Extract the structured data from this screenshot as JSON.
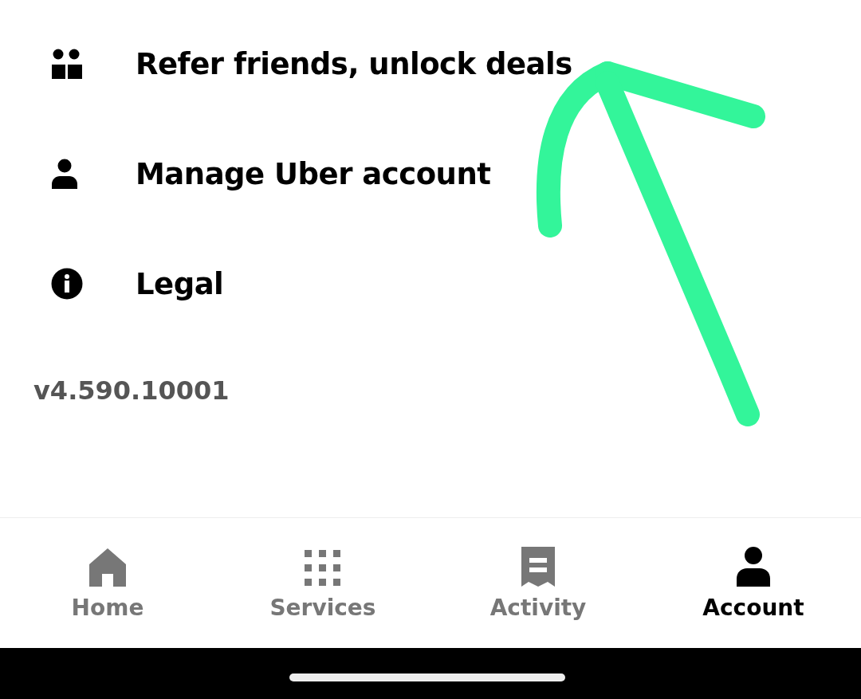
{
  "menu_items": [
    {
      "label": "Refer friends, unlock deals"
    },
    {
      "label": "Manage Uber account"
    },
    {
      "label": "Legal"
    }
  ],
  "version": "v4.590.10001",
  "bottom_nav": [
    {
      "label": "Home",
      "selected": false
    },
    {
      "label": "Services",
      "selected": false
    },
    {
      "label": "Activity",
      "selected": false
    },
    {
      "label": "Account",
      "selected": true
    }
  ]
}
